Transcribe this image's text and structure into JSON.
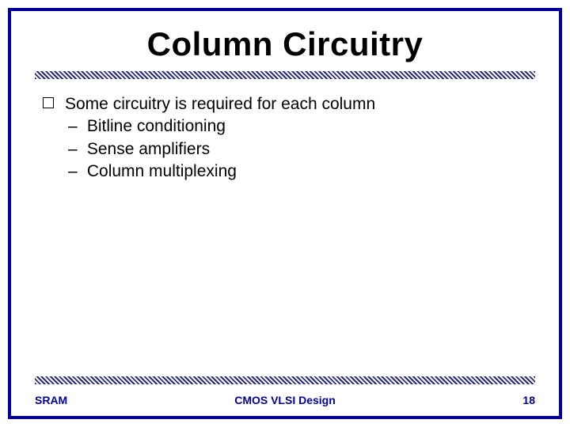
{
  "title": "Column Circuitry",
  "bullet": "Some circuitry is required for each column",
  "subs": {
    "a": "Bitline conditioning",
    "b": "Sense amplifiers",
    "c": "Column multiplexing"
  },
  "footer": {
    "left": "SRAM",
    "center": "CMOS VLSI Design",
    "right": "18"
  }
}
